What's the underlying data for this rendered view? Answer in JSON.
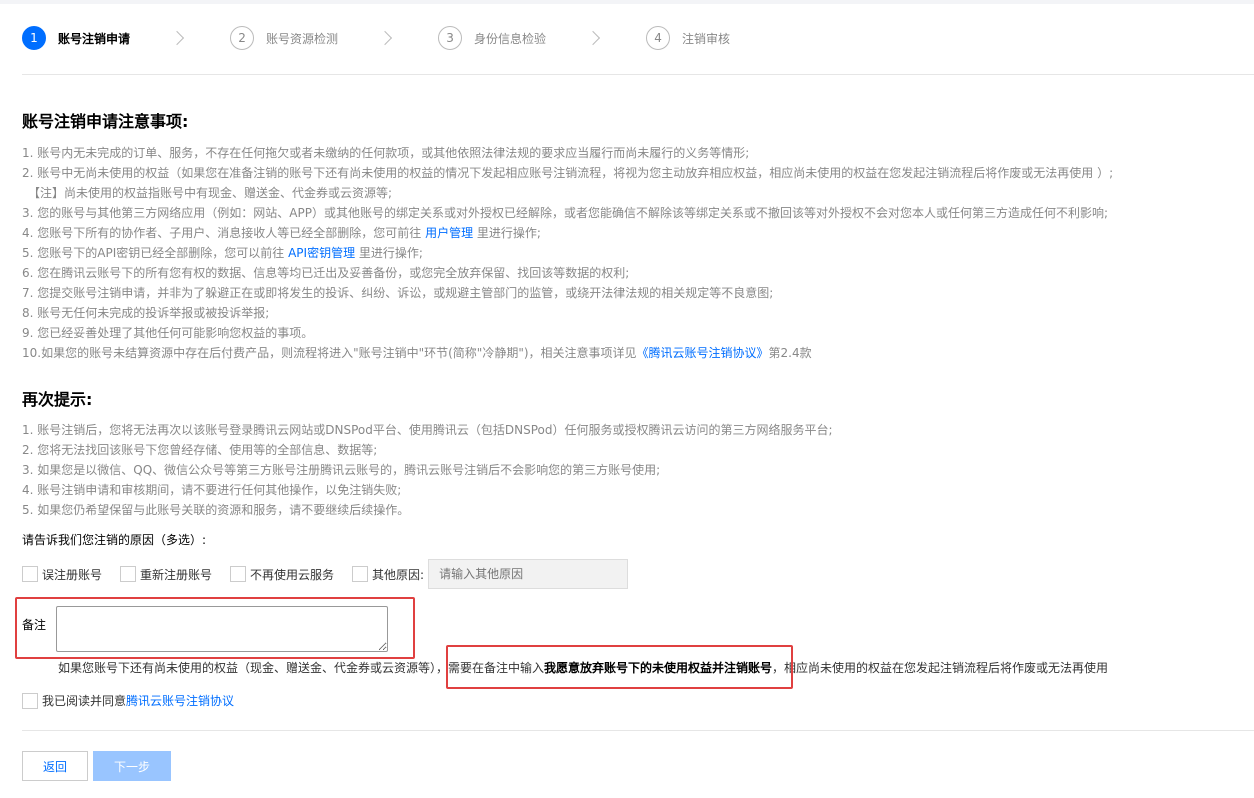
{
  "steps": [
    {
      "num": "1",
      "label": "账号注销申请"
    },
    {
      "num": "2",
      "label": "账号资源检测"
    },
    {
      "num": "3",
      "label": "身份信息检验"
    },
    {
      "num": "4",
      "label": "注销审核"
    }
  ],
  "notice": {
    "title": "账号注销申请注意事项:",
    "items": [
      {
        "pre": "1. 账号内无未完成的订单、服务，不存在任何拖欠或者未缴纳的任何款项，或其他依照法律法规的要求应当履行而尚未履行的义务等情形;"
      },
      {
        "pre": "2. 账号中无尚未使用的权益（如果您在准备注销的账号下还有尚未使用的权益的情况下发起相应账号注销流程，将视为您主动放弃相应权益，相应尚未使用的权益在您发起注销流程后将作废或无法再使用 ）;"
      },
      {
        "pre": "　【注】尚未使用的权益指账号中有现金、赠送金、代金券或云资源等;"
      },
      {
        "pre": "3. 您的账号与其他第三方网络应用（例如：网站、APP）或其他账号的绑定关系或对外授权已经解除，或者您能确信不解除该等绑定关系或不撤回该等对外授权不会对您本人或任何第三方造成任何不利影响;"
      },
      {
        "pre": "4. 您账号下所有的协作者、子用户、消息接收人等已经全部删除，您可前往 ",
        "link": "用户管理",
        "post": " 里进行操作;"
      },
      {
        "pre": "5. 您账号下的API密钥已经全部删除，您可以前往 ",
        "link": "API密钥管理",
        "post": " 里进行操作;"
      },
      {
        "pre": "6. 您在腾讯云账号下的所有您有权的数据、信息等均已迁出及妥善备份，或您完全放弃保留、找回该等数据的权利;"
      },
      {
        "pre": "7. 您提交账号注销申请，并非为了躲避正在或即将发生的投诉、纠纷、诉讼，或规避主管部门的监管，或绕开法律法规的相关规定等不良意图;"
      },
      {
        "pre": "8. 账号无任何未完成的投诉举报或被投诉举报;"
      },
      {
        "pre": "9. 您已经妥善处理了其他任何可能影响您权益的事项。"
      },
      {
        "pre": "10.如果您的账号未结算资源中存在后付费产品，则流程将进入\"账号注销中\"环节(简称\"冷静期\")，相关注意事项详见",
        "link": "《腾讯云账号注销协议》",
        "post": "第2.4款"
      }
    ]
  },
  "reminder": {
    "title": "再次提示:",
    "items": [
      "1. 账号注销后，您将无法再次以该账号登录腾讯云网站或DNSPod平台、使用腾讯云（包括DNSPod）任何服务或授权腾讯云访问的第三方网络服务平台;",
      "2. 您将无法找回该账号下您曾经存储、使用等的全部信息、数据等;",
      "3. 如果您是以微信、QQ、微信公众号等第三方账号注册腾讯云账号的，腾讯云账号注销后不会影响您的第三方账号使用;",
      "4. 账号注销申请和审核期间，请不要进行任何其他操作，以免注销失败;",
      "5. 如果您仍希望保留与此账号关联的资源和服务，请不要继续后续操作。"
    ]
  },
  "reasons": {
    "title": "请告诉我们您注销的原因（多选）:",
    "options": [
      "误注册账号",
      "重新注册账号",
      "不再使用云服务",
      "其他原因:"
    ],
    "other_placeholder": "请输入其他原因"
  },
  "remark": {
    "label": "备注",
    "note_pre": "如果您账号下还有尚未使用的权益（现金、赠送金、代金券或云资源等），需要在备注中输入",
    "note_bold": "我愿意放弃账号下的未使用权益并注销账号",
    "note_post": "，相应尚未使用的权益在您发起注销流程后将作废或无法再使用"
  },
  "agreement": {
    "pre": "我已阅读并同意",
    "link": "腾讯云账号注销协议"
  },
  "buttons": {
    "back": "返回",
    "next": "下一步"
  }
}
